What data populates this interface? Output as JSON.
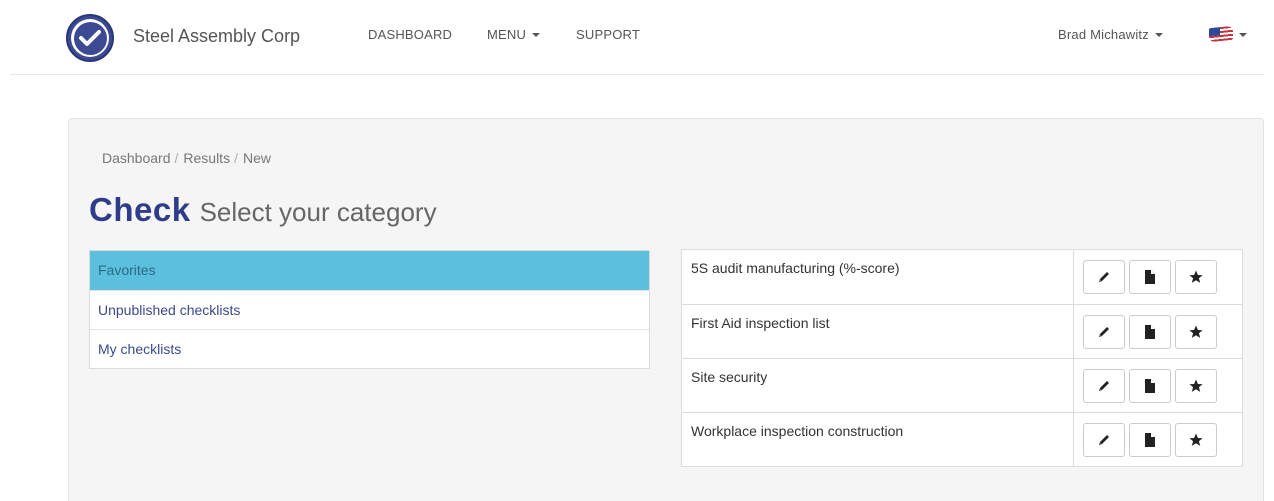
{
  "brand": {
    "name": "Steel Assembly Corp",
    "logo_icon": "check-circle-icon",
    "accent_color": "#3b4a92"
  },
  "nav": {
    "dashboard": "DASHBOARD",
    "menu": "MENU",
    "support": "SUPPORT",
    "user": "Brad Michawitz",
    "language_icon": "us-flag-icon"
  },
  "breadcrumb": [
    "Dashboard",
    "Results",
    "New"
  ],
  "heading": {
    "main": "Check",
    "sub": "Select your category"
  },
  "categories": [
    {
      "label": "Favorites",
      "active": true
    },
    {
      "label": "Unpublished checklists",
      "active": false
    },
    {
      "label": "My checklists",
      "active": false
    }
  ],
  "checklists": [
    {
      "name": "5S audit manufacturing (%-score)"
    },
    {
      "name": "First Aid inspection list"
    },
    {
      "name": "Site security"
    },
    {
      "name": "Workplace inspection construction"
    }
  ],
  "row_actions": [
    "pencil-icon",
    "file-icon",
    "star-icon"
  ],
  "colors": {
    "active_category": "#5bc0de",
    "title": "#2f3c8a",
    "link": "#3a4a8c"
  }
}
